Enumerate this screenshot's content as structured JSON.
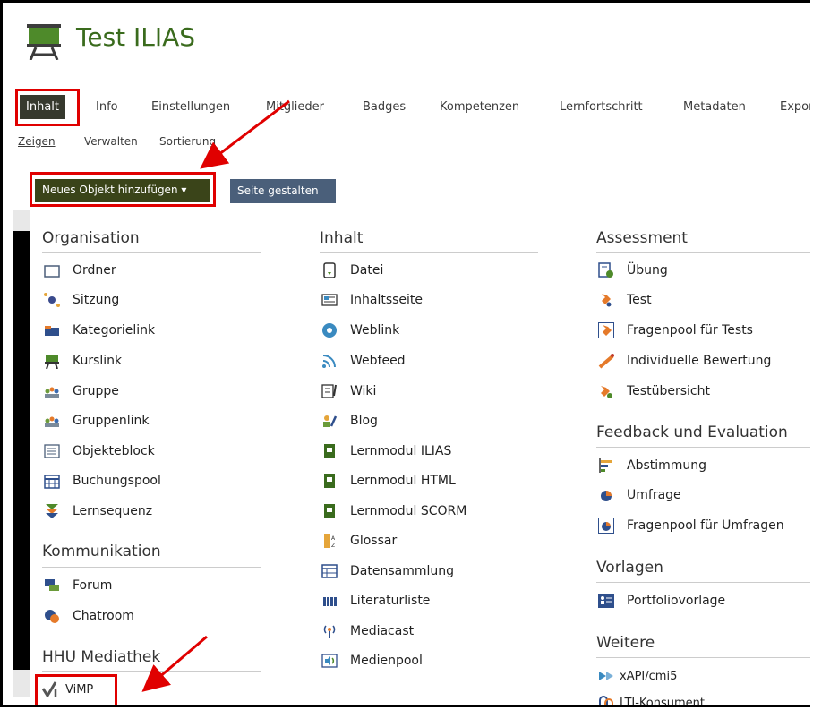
{
  "header": {
    "title": "Test ILIAS"
  },
  "tabs": [
    {
      "label": "Inhalt"
    },
    {
      "label": "Info"
    },
    {
      "label": "Einstellungen"
    },
    {
      "label": "Mitglieder"
    },
    {
      "label": "Badges"
    },
    {
      "label": "Kompetenzen"
    },
    {
      "label": "Lernfortschritt"
    },
    {
      "label": "Metadaten"
    },
    {
      "label": "Expor"
    }
  ],
  "subtabs": [
    {
      "label": "Zeigen"
    },
    {
      "label": "Verwalten"
    },
    {
      "label": "Sortierung"
    }
  ],
  "toolbar": {
    "add_label": "Neues Objekt hinzufügen ▾",
    "page_label": "Seite gestalten"
  },
  "groups": {
    "organisation": {
      "title": "Organisation",
      "items": [
        "Ordner",
        "Sitzung",
        "Kategorielink",
        "Kurslink",
        "Gruppe",
        "Gruppenlink",
        "Objekteblock",
        "Buchungspool",
        "Lernsequenz"
      ]
    },
    "kommunikation": {
      "title": "Kommunikation",
      "items": [
        "Forum",
        "Chatroom"
      ]
    },
    "mediathek": {
      "title": "HHU Mediathek",
      "items": [
        "ViMP"
      ]
    },
    "inhalt": {
      "title": "Inhalt",
      "items": [
        "Datei",
        "Inhaltsseite",
        "Weblink",
        "Webfeed",
        "Wiki",
        "Blog",
        "Lernmodul ILIAS",
        "Lernmodul HTML",
        "Lernmodul SCORM",
        "Glossar",
        "Datensammlung",
        "Literaturliste",
        "Mediacast",
        "Medienpool"
      ]
    },
    "assessment": {
      "title": "Assessment",
      "items": [
        "Übung",
        "Test",
        "Fragenpool für Tests",
        "Individuelle Bewertung",
        "Testübersicht"
      ]
    },
    "feedback": {
      "title": "Feedback und Evaluation",
      "items": [
        "Abstimmung",
        "Umfrage",
        "Fragenpool für Umfragen"
      ]
    },
    "vorlagen": {
      "title": "Vorlagen",
      "items": [
        "Portfoliovorlage"
      ]
    },
    "weitere": {
      "title": "Weitere",
      "items": [
        "xAPI/cmi5",
        "LTI-Konsument"
      ]
    }
  },
  "colors": {
    "accent": "#3a6b1d",
    "highlight": "#e00000",
    "add_button": "#3a4419",
    "page_button": "#4a5f7a"
  }
}
